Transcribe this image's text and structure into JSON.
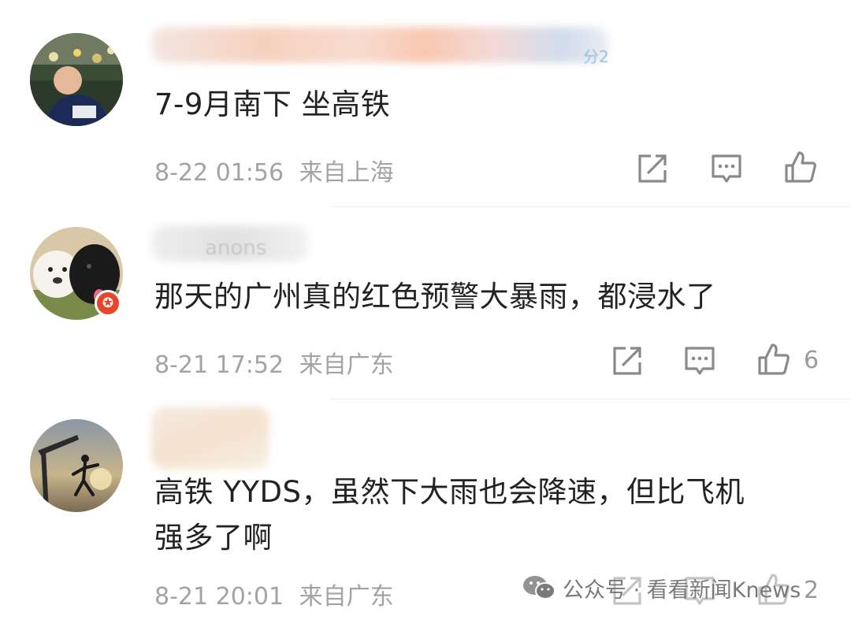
{
  "comments": [
    {
      "avatar_icon": "user-avatar-icon",
      "name_tag": "分2",
      "text": "7-9月南下 坐高铁",
      "time": "8-22 01:56",
      "location": "来自上海",
      "likes": ""
    },
    {
      "avatar_icon": "dog-avatar-icon",
      "name_tag": "anons",
      "text": "那天的广州真的红色预警大暴雨，都浸水了",
      "time": "8-21 17:52",
      "location": "来自广东",
      "likes": "6"
    },
    {
      "avatar_icon": "silhouette-avatar-icon",
      "name_tag": "",
      "text_line1": "高铁 YYDS，虽然下大雨也会降速，但比飞机",
      "text_line2": "强多了啊",
      "time": "8-21 20:01",
      "location": "来自广东",
      "likes": "2"
    }
  ],
  "watermark": {
    "text": "公众号 · 看看新闻Knews",
    "icon": "wechat-icon"
  },
  "icons": {
    "share": "share-icon",
    "reply": "comment-icon",
    "like": "thumbs-up-icon"
  },
  "colors": {
    "text": "#222222",
    "meta": "#a3a3a3",
    "badge": "#e8462a"
  }
}
